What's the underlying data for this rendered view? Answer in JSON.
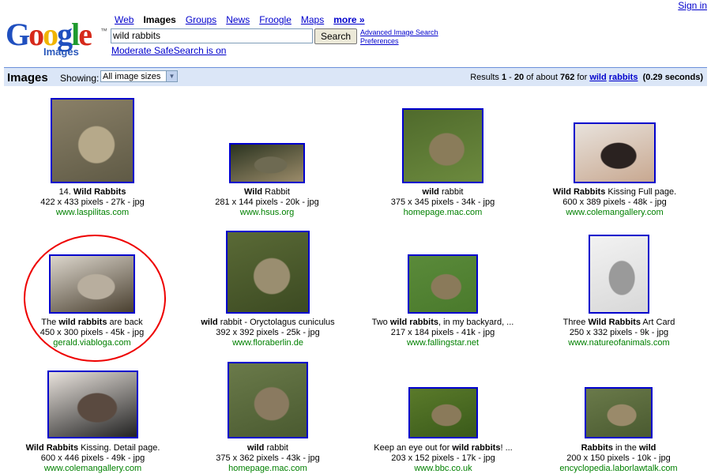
{
  "header": {
    "sign_in": "Sign in",
    "logo_text": "Google",
    "logo_sub": "Images",
    "nav": [
      {
        "label": "Web",
        "active": false
      },
      {
        "label": "Images",
        "active": true
      },
      {
        "label": "Groups",
        "active": false
      },
      {
        "label": "News",
        "active": false
      },
      {
        "label": "Froogle",
        "active": false
      },
      {
        "label": "Maps",
        "active": false
      },
      {
        "label": "more »",
        "active": false
      }
    ],
    "search_value": "wild rabbits",
    "search_button": "Search",
    "advanced_link": "Advanced Image Search",
    "preferences_link": "Preferences",
    "safesearch": "Moderate SafeSearch is on"
  },
  "results_bar": {
    "title": "Images",
    "showing_label": "Showing:",
    "size_select": "All image sizes",
    "results_prefix": "Results ",
    "range_start": "1",
    "range_sep": " - ",
    "range_end": "20",
    "of_about": " of about ",
    "total": "762",
    "for_text": " for ",
    "q1": "wild",
    "q2": "rabbits",
    "time_text": "(0.29 seconds)"
  },
  "results": [
    {
      "caption_html": "14. <b>Wild Rabbits</b>",
      "meta": "422 x 433 pixels - 27k - jpg",
      "site": "www.laspilitas.com",
      "colors": [
        "#8a8068",
        "#b6a98a",
        "#5f5a45"
      ]
    },
    {
      "caption_html": "<b>Wild</b> Rabbit",
      "meta": "281 x 144 pixels - 20k - jpg",
      "site": "www.hsus.org",
      "colors": [
        "#2a3320",
        "#6e6a52",
        "#9c8c6a"
      ]
    },
    {
      "caption_html": "<b>wild</b> rabbit",
      "meta": "375 x 345 pixels - 34k - jpg",
      "site": "homepage.mac.com",
      "colors": [
        "#4f6a2c",
        "#8a7c5a",
        "#6c8a3e"
      ]
    },
    {
      "caption_html": "<b>Wild Rabbits</b> Kissing Full page.",
      "meta": "600 x 389 pixels - 48k - jpg",
      "site": "www.colemangallery.com",
      "colors": [
        "#e8e2dc",
        "#2a2220",
        "#c8a890"
      ]
    },
    {
      "caption_html": "The <b>wild rabbits</b> are back",
      "meta": "450 x 300 pixels - 45k - jpg",
      "site": "gerald.viabloga.com",
      "colors": [
        "#dcd6cc",
        "#b8ae9e",
        "#4a4030"
      ]
    },
    {
      "caption_html": "<b>wild</b> rabbit - Oryctolagus cuniculus",
      "meta": "392 x 392 pixels - 25k - jpg",
      "site": "www.floraberlin.de",
      "colors": [
        "#5a6a36",
        "#9a8e70",
        "#3c4a22"
      ]
    },
    {
      "caption_html": "Two <b>wild rabbits</b>, in my backyard, ...",
      "meta": "217 x 184 pixels - 41k - jpg",
      "site": "www.fallingstar.net",
      "colors": [
        "#5a8a3a",
        "#8a7a5a",
        "#4a7a2c"
      ]
    },
    {
      "caption_html": "Three <b>Wild Rabbits</b> Art Card",
      "meta": "250 x 332 pixels - 9k - jpg",
      "site": "www.natureofanimals.com",
      "colors": [
        "#f2f2f2",
        "#9a9a9a",
        "#d8d8d8"
      ]
    },
    {
      "caption_html": "<b>Wild Rabbits</b> Kissing. Detail page.",
      "meta": "600 x 446 pixels - 49k - jpg",
      "site": "www.colemangallery.com",
      "colors": [
        "#e8e2dc",
        "#5a4a40",
        "#222222"
      ]
    },
    {
      "caption_html": "<b>wild</b> rabbit",
      "meta": "375 x 362 pixels - 43k - jpg",
      "site": "homepage.mac.com",
      "colors": [
        "#6a7a4a",
        "#8a7a60",
        "#4a5a30"
      ]
    },
    {
      "caption_html": "Keep an eye out for <b>wild rabbits</b>! ...",
      "meta": "203 x 152 pixels - 17k - jpg",
      "site": "www.bbc.co.uk",
      "colors": [
        "#5a7a2a",
        "#8a7a5a",
        "#3a5a1a"
      ]
    },
    {
      "caption_html": "<b>Rabbits</b> in the <b>wild</b>",
      "meta": "200 x 150 pixels - 10k - jpg",
      "site": "encyclopedia.laborlawtalk.com",
      "colors": [
        "#6a7a4a",
        "#9a8a6a",
        "#4a5a30"
      ]
    }
  ]
}
